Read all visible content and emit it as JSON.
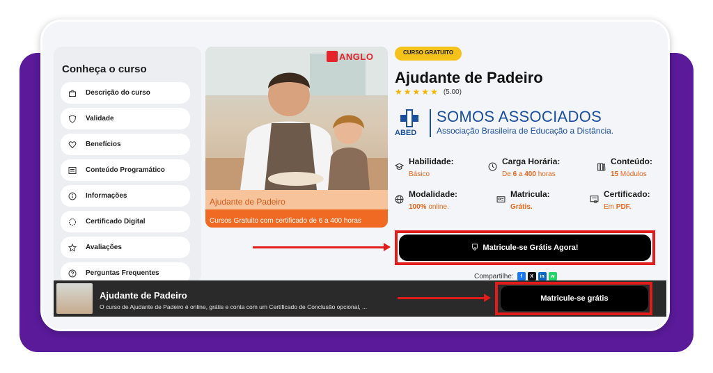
{
  "sidebar": {
    "title": "Conheça o curso",
    "items": [
      {
        "label": "Descrição do curso",
        "icon": "book-icon"
      },
      {
        "label": "Validade",
        "icon": "shield-icon"
      },
      {
        "label": "Benefícios",
        "icon": "heart-icon"
      },
      {
        "label": "Conteúdo Programático",
        "icon": "list-icon"
      },
      {
        "label": "Informações",
        "icon": "info-icon"
      },
      {
        "label": "Certificado Digital",
        "icon": "certificate-icon"
      },
      {
        "label": "Avaliações",
        "icon": "star-icon"
      },
      {
        "label": "Perguntas Frequentes",
        "icon": "question-icon"
      }
    ]
  },
  "course_image": {
    "brand": "ANGLO",
    "caption": "Ajudante de Padeiro",
    "subcaption": "Cursos Gratuito com certificado de 6 a 400 horas"
  },
  "course": {
    "badge": "CURSO GRATUITO",
    "title": "Ajudante de Padeiro",
    "stars": 5,
    "rating_text": "(5.00)"
  },
  "partner": {
    "short": "ABED",
    "title": "SOMOS ASSOCIADOS",
    "subtitle": "Associação Brasileira de Educação a Distância."
  },
  "info": {
    "habilidade": {
      "label": "Habilidade:",
      "value": "Básico"
    },
    "carga": {
      "label": "Carga Horária:",
      "prefix": "De ",
      "min": "6",
      "mid": " a ",
      "max": "400",
      "suffix": " horas"
    },
    "conteudo": {
      "label": "Conteúdo:",
      "num": "15",
      "suffix": " Módulos"
    },
    "modalidade": {
      "label": "Modalidade:",
      "bold": "100%",
      "suffix": " online."
    },
    "matricula": {
      "label": "Matricula:",
      "value": "Grátis."
    },
    "certificado": {
      "label": "Certificado:",
      "prefix": "Em ",
      "bold": "PDF."
    }
  },
  "cta": {
    "label": "Matricule-se Grátis Agora!"
  },
  "share": {
    "label": "Compartilhe:",
    "buttons": [
      "f",
      "X",
      "in",
      "w"
    ]
  },
  "bottom_bar": {
    "title": "Ajudante de Padeiro",
    "description": "O curso de Ajudante de Padeiro é online, grátis e conta com um Certificado de Conclusão opcional, ...",
    "button": "Matricule-se grátis"
  },
  "colors": {
    "purple": "#5a1a9a",
    "accent_orange": "#e8651a",
    "badge_yellow": "#f4c21a",
    "highlight_red": "#e21b1b",
    "abed_blue": "#1a4fa0"
  }
}
